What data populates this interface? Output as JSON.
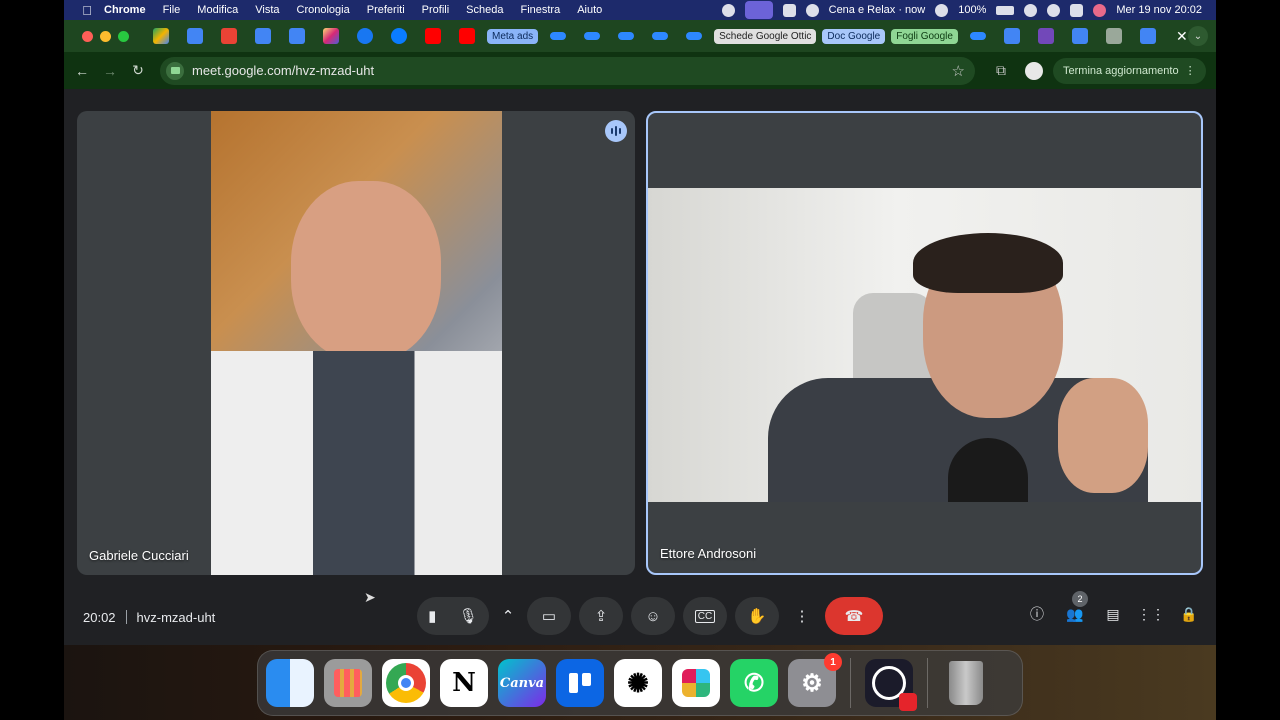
{
  "menubar": {
    "app": "Chrome",
    "items": [
      "File",
      "Modifica",
      "Vista",
      "Cronologia",
      "Preferiti",
      "Profili",
      "Scheda",
      "Finestra",
      "Aiuto"
    ],
    "now_playing": "Cena e Relax · now",
    "battery": "100%",
    "datetime": "Mer 19 nov  20:02"
  },
  "tabs": {
    "pills": [
      {
        "label": "Meta ads",
        "bg": "#8ab4f8",
        "fg": "#0b2a5b"
      },
      {
        "label": "Schede Google Ottic",
        "bg": "#e0e0e0",
        "fg": "#222"
      },
      {
        "label": "Doc Google",
        "bg": "#a8c7fa",
        "fg": "#0b2a5b"
      },
      {
        "label": "Fogli Google",
        "bg": "#8fd694",
        "fg": "#0d3b12"
      }
    ]
  },
  "omnibox": {
    "url": "meet.google.com/hvz-mzad-uht",
    "update_label": "Termina aggiornamento"
  },
  "participants": [
    {
      "name": "Gabriele Cucciari"
    },
    {
      "name": "Ettore Androsoni"
    }
  ],
  "meeting": {
    "time": "20:02",
    "code": "hvz-mzad-uht",
    "participants_count": "2"
  },
  "dock": {
    "apps": [
      {
        "name": "Finder",
        "label": ""
      },
      {
        "name": "Launchpad",
        "label": ""
      },
      {
        "name": "Chrome",
        "label": ""
      },
      {
        "name": "Notion",
        "label": "N"
      },
      {
        "name": "Canva",
        "label": "Canva"
      },
      {
        "name": "Trello",
        "label": ""
      },
      {
        "name": "ChatGPT",
        "label": ""
      },
      {
        "name": "Slack",
        "label": ""
      },
      {
        "name": "WhatsApp",
        "label": ""
      },
      {
        "name": "System Settings",
        "label": "",
        "badge": "1"
      },
      {
        "name": "OBS",
        "label": ""
      },
      {
        "name": "Trash",
        "label": ""
      }
    ]
  }
}
